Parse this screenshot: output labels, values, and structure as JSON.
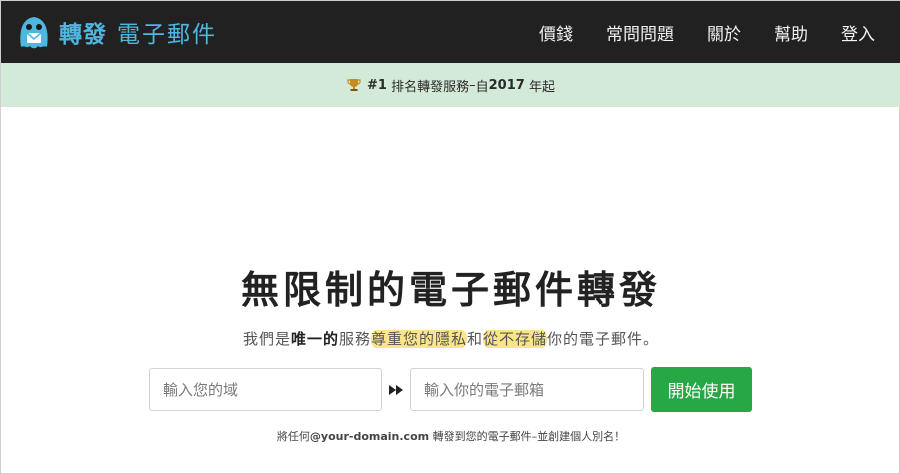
{
  "brand": {
    "name_bold": "轉發",
    "name_light": "電子郵件"
  },
  "nav": {
    "items": [
      {
        "label": "價錢"
      },
      {
        "label": "常問問題"
      },
      {
        "label": "關於"
      },
      {
        "label": "幫助"
      },
      {
        "label": "登入"
      }
    ]
  },
  "banner": {
    "rank": "#1",
    "text_a": "排名轉發服務",
    "sep": "–",
    "text_b": "自",
    "year": "2017",
    "text_c": "年起"
  },
  "hero": {
    "title": "無限制的電子郵件轉發",
    "sub_1": "我們是",
    "sub_bold": "唯一的",
    "sub_2": "服務",
    "sub_hl1": "尊重您的隱私",
    "sub_3": "和",
    "sub_hl2": "從不存儲",
    "sub_4": "你的電子郵件。"
  },
  "form": {
    "domain_placeholder": "輸入您的域",
    "email_placeholder": "輸入你的電子郵箱",
    "submit_label": "開始使用"
  },
  "footnote": {
    "prefix": "將任何",
    "domain": "@your-domain.com",
    "suffix": " 轉發到您的電子郵件–並創建個人別名！"
  },
  "colors": {
    "navbar": "#212121",
    "brand": "#4fb6e0",
    "banner": "#d4ead8",
    "highlight": "#fbe58a",
    "button": "#28a745"
  },
  "icons": {
    "brand": "mascot-icon",
    "banner": "trophy-icon",
    "arrow": "fast-forward-icon"
  }
}
